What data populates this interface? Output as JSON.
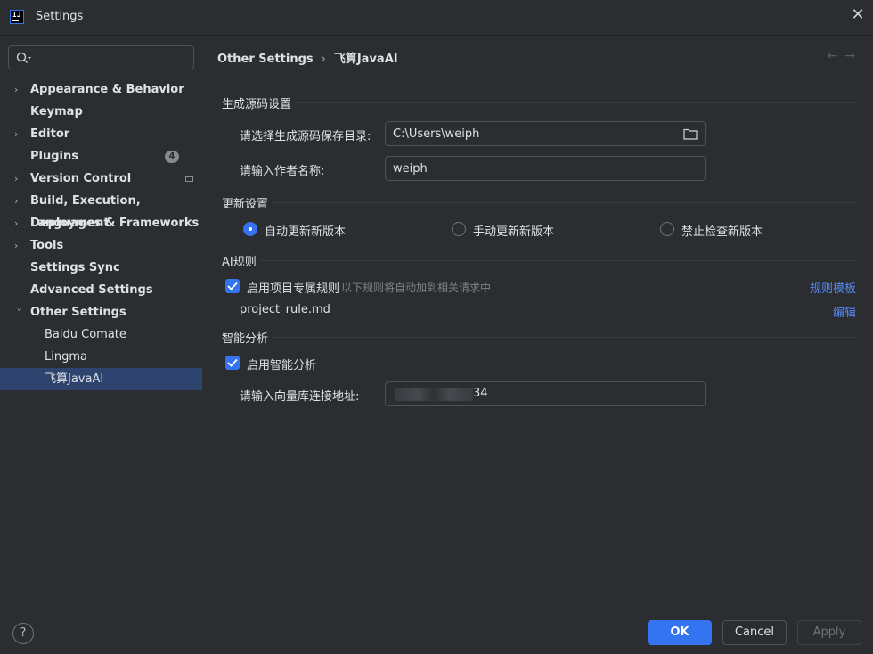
{
  "window": {
    "title": "Settings",
    "app_icon_text": "IJ"
  },
  "search": {
    "placeholder": "",
    "value": ""
  },
  "sidebar": {
    "items": [
      {
        "label": "Appearance & Behavior",
        "expandable": true
      },
      {
        "label": "Keymap",
        "expandable": false
      },
      {
        "label": "Editor",
        "expandable": true
      },
      {
        "label": "Plugins",
        "expandable": false,
        "badge": "4"
      },
      {
        "label": "Version Control",
        "expandable": true
      },
      {
        "label": "Build, Execution, Deployment",
        "expandable": true
      },
      {
        "label": "Languages & Frameworks",
        "expandable": true
      },
      {
        "label": "Tools",
        "expandable": true
      },
      {
        "label": "Settings Sync",
        "expandable": false
      },
      {
        "label": "Advanced Settings",
        "expandable": false
      },
      {
        "label": "Other Settings",
        "expandable": true,
        "expanded": true
      }
    ],
    "children": [
      {
        "label": "Baidu Comate"
      },
      {
        "label": "Lingma"
      },
      {
        "label": "飞算JavaAI",
        "selected": true
      }
    ]
  },
  "breadcrumb": {
    "parent": "Other Settings",
    "current": "飞算JavaAI",
    "separator": "›"
  },
  "nav": {
    "back": "←",
    "forward": "→"
  },
  "source_gen": {
    "title": "生成源码设置",
    "dir_label": "请选择生成源码保存目录:",
    "dir_value": "C:\\Users\\weiph",
    "author_label": "请输入作者名称:",
    "author_value": "weiph"
  },
  "update": {
    "title": "更新设置",
    "options": [
      {
        "label": "自动更新新版本",
        "checked": true
      },
      {
        "label": "手动更新新版本",
        "checked": false
      },
      {
        "label": "禁止检查新版本",
        "checked": false
      }
    ]
  },
  "ai_rules": {
    "title": "AI规则",
    "enable_label": "启用项目专属规则",
    "enable_checked": true,
    "hint": "以下规则将自动加到相关请求中",
    "template_link": "规则模板",
    "file_name": "project_rule.md",
    "edit_link": "编辑"
  },
  "analysis": {
    "title": "智能分析",
    "enable_label": "启用智能分析",
    "enable_checked": true,
    "db_label": "请输入向量库连接地址:",
    "db_value_visible": "34"
  },
  "footer": {
    "help": "?",
    "ok": "OK",
    "cancel": "Cancel",
    "apply": "Apply"
  },
  "colors": {
    "accent": "#3574f0",
    "link": "#548af7",
    "selection": "#2e436e",
    "background": "#2b2d30"
  }
}
